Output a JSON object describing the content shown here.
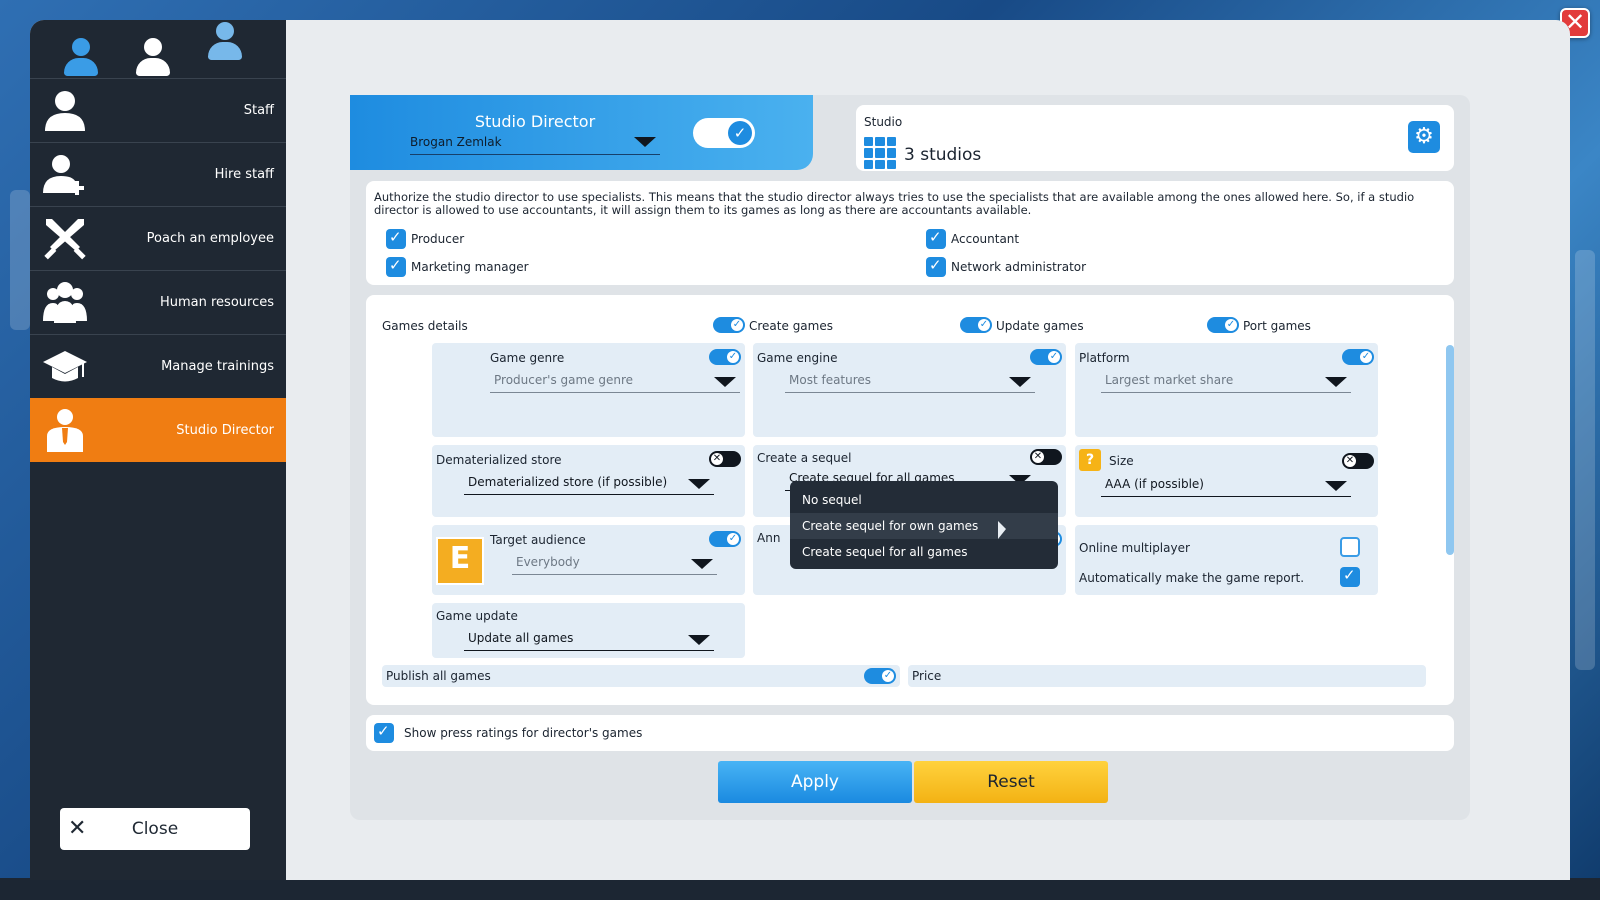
{
  "window": {
    "close_icon": "close-icon"
  },
  "sidebar": {
    "tabs": [
      "person-icon-blue",
      "person-icon-white",
      "person-icon-light"
    ],
    "items": [
      {
        "label": "Staff",
        "icon": "person-icon"
      },
      {
        "label": "Hire staff",
        "icon": "person-add-icon"
      },
      {
        "label": "Poach an employee",
        "icon": "crossed-swords-icon"
      },
      {
        "label": "Human resources",
        "icon": "group-icon"
      },
      {
        "label": "Manage trainings",
        "icon": "graduation-cap-icon"
      },
      {
        "label": "Studio Director",
        "icon": "director-icon"
      }
    ],
    "active_index": 5,
    "close_label": "Close"
  },
  "director": {
    "title": "Studio Director",
    "selected": "Brogan Zemlak",
    "enabled": true
  },
  "studio": {
    "label": "Studio",
    "value": "3 studios"
  },
  "authorize": {
    "description": "Authorize the studio director to use specialists. This means that the studio director always tries to use the specialists that are available among the ones allowed here. So, if a studio director is allowed to use accountants, it will assign them to its games as long as there are accountants available.",
    "producer": "Producer",
    "marketing": "Marketing manager",
    "accountant": "Accountant",
    "network": "Network administrator"
  },
  "games": {
    "title": "Games details",
    "create": "Create games",
    "update": "Update games",
    "port": "Port games",
    "genre": {
      "label": "Game genre",
      "value": "Producer's game genre"
    },
    "engine": {
      "label": "Game engine",
      "value": "Most features"
    },
    "platform": {
      "label": "Platform",
      "value": "Largest market share"
    },
    "store": {
      "label": "Dematerialized store",
      "value": "Dematerialized store (if possible)"
    },
    "sequel": {
      "label": "Create a sequel",
      "value": "Create sequel for all games"
    },
    "size": {
      "label": "Size",
      "value": "AAA (if possible)"
    },
    "audience": {
      "label": "Target audience",
      "value": "Everybody",
      "badge": "E"
    },
    "announce_partial": "Ann",
    "online": "Online multiplayer",
    "auto_report": "Automatically make the game report.",
    "game_update": {
      "label": "Game update",
      "value": "Update all games"
    },
    "publish": "Publish all games",
    "price": "Price"
  },
  "sequel_popup": {
    "options": [
      "No sequel",
      "Create sequel for own games",
      "Create sequel for all games"
    ],
    "hovered": 1
  },
  "press": {
    "label": "Show press ratings for director's games"
  },
  "actions": {
    "apply": "Apply",
    "reset": "Reset"
  }
}
